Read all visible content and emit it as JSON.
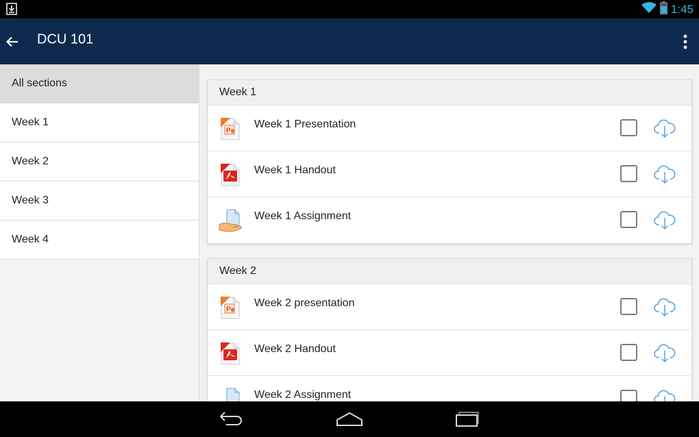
{
  "status_bar": {
    "time": "1:45",
    "icons": [
      "download-notification-icon",
      "wifi-icon",
      "battery-icon"
    ],
    "accent_color": "#33b5e5"
  },
  "app_bar": {
    "title": "DCU 101",
    "background_color": "#0d2a4e",
    "icons": [
      "back-arrow-icon",
      "overflow-menu-icon"
    ]
  },
  "sidebar": {
    "items": [
      {
        "label": "All sections",
        "selected": true
      },
      {
        "label": "Week 1",
        "selected": false
      },
      {
        "label": "Week 2",
        "selected": false
      },
      {
        "label": "Week 3",
        "selected": false
      },
      {
        "label": "Week 4",
        "selected": false
      }
    ]
  },
  "sections": [
    {
      "title": "Week 1",
      "files": [
        {
          "name": "Week 1 Presentation",
          "icon": "powerpoint-icon",
          "checked": false
        },
        {
          "name": "Week 1 Handout",
          "icon": "pdf-icon",
          "checked": false
        },
        {
          "name": "Week 1 Assignment",
          "icon": "assignment-icon",
          "checked": false
        }
      ]
    },
    {
      "title": "Week 2",
      "files": [
        {
          "name": "Week 2 presentation",
          "icon": "powerpoint-icon",
          "checked": false
        },
        {
          "name": "Week 2 Handout",
          "icon": "pdf-icon",
          "checked": false
        },
        {
          "name": "Week 2 Assignment",
          "icon": "assignment-icon",
          "checked": false
        }
      ]
    }
  ],
  "nav_bar": {
    "icons": [
      "back-nav-icon",
      "home-icon",
      "recent-apps-icon"
    ]
  }
}
